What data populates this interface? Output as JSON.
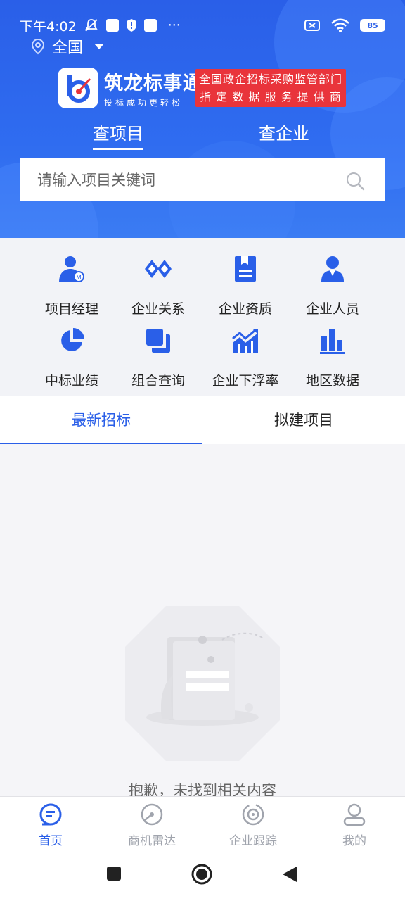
{
  "status_bar": {
    "time": "下午4:02",
    "dots": "···",
    "battery": "85"
  },
  "location": {
    "label": "全国"
  },
  "brand": {
    "name": "筑龙标事通",
    "slogan": "投标成功更轻松",
    "tag_line1": "全国政企招标采购监管部门",
    "tag_line2": "指 定 数 据 服 务 提 供 商"
  },
  "search_tabs": {
    "project": "查项目",
    "company": "查企业"
  },
  "search": {
    "placeholder": "请输入项目关键词"
  },
  "quick_menu": [
    {
      "label": "项目经理",
      "icon": "project-manager-icon"
    },
    {
      "label": "企业关系",
      "icon": "company-relation-icon"
    },
    {
      "label": "企业资质",
      "icon": "company-qualification-icon"
    },
    {
      "label": "企业人员",
      "icon": "company-staff-icon"
    },
    {
      "label": "中标业绩",
      "icon": "bid-performance-icon"
    },
    {
      "label": "组合查询",
      "icon": "combined-query-icon"
    },
    {
      "label": "企业下浮率",
      "icon": "discount-rate-icon"
    },
    {
      "label": "地区数据",
      "icon": "region-data-icon"
    }
  ],
  "list_tabs": {
    "latest": "最新招标",
    "planned": "拟建项目"
  },
  "empty_state": {
    "message": "抱歉，未找到相关内容"
  },
  "bottom_nav": [
    {
      "label": "首页",
      "icon": "home-icon",
      "active": true
    },
    {
      "label": "商机雷达",
      "icon": "radar-icon",
      "active": false
    },
    {
      "label": "企业跟踪",
      "icon": "tracking-icon",
      "active": false
    },
    {
      "label": "我的",
      "icon": "profile-icon",
      "active": false
    }
  ],
  "colors": {
    "primary": "#2a5fe8",
    "tag_red": "#e9343b"
  }
}
